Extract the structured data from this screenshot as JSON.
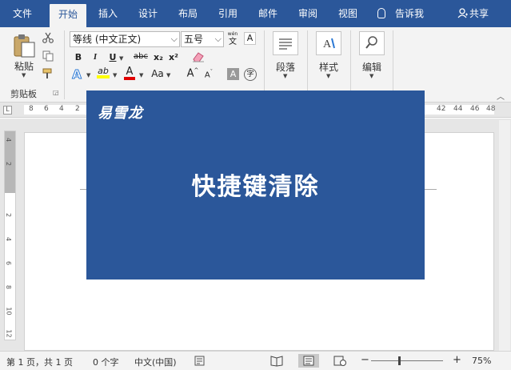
{
  "tabs": {
    "file": "文件",
    "home": "开始",
    "insert": "插入",
    "design": "设计",
    "layout": "布局",
    "references": "引用",
    "mailings": "邮件",
    "review": "审阅",
    "view": "视图"
  },
  "tell_me": "告诉我",
  "share": "共享",
  "ribbon": {
    "paste_label": "粘贴",
    "clipboard_group": "剪贴板",
    "font_name": "等线 (中文正文)",
    "font_size": "五号",
    "wen_glyph": "文",
    "a_box": "A",
    "bold": "B",
    "italic": "I",
    "underline": "U",
    "strike": "abc",
    "subscript": "x₂",
    "superscript": "x²",
    "text_effect": "A",
    "highlight": "ab",
    "font_color": "A",
    "char_shade": "Aa",
    "grow_font": "A",
    "shrink_font": "A",
    "char_border": "A",
    "enclose_char": "字",
    "paragraph_label": "段落",
    "styles_label": "样式",
    "editing_label": "编辑"
  },
  "ruler": {
    "corner": "L",
    "left_numbers": [
      "8",
      "6",
      "4",
      "2"
    ],
    "right_numbers": [
      "42",
      "44",
      "46",
      "48"
    ],
    "vertical_numbers": [
      "4",
      "2",
      "2",
      "4",
      "6",
      "8",
      "10",
      "12"
    ]
  },
  "banner": {
    "brand": "易雪龙",
    "headline": "快捷键清除"
  },
  "status": {
    "page": "第 1 页，共 1 页",
    "words": "0 个字",
    "language": "中文(中国)",
    "zoom_minus": "−",
    "zoom_plus": "+",
    "zoom": "75%"
  },
  "colors": {
    "accent": "#2b579a",
    "ribbon_bg": "#f3f3f3",
    "highlight_yellow": "#ffff00",
    "font_red": "#e00000"
  }
}
